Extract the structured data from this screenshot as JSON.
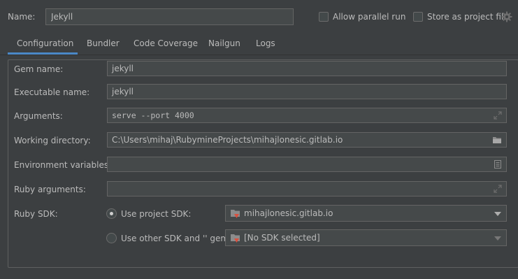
{
  "header": {
    "name_label": "Name:",
    "name_value": "Jekyll",
    "allow_parallel_run": {
      "label": "Allow parallel run",
      "checked": false
    },
    "store_as_project_file": {
      "label": "Store as project file",
      "checked": false
    },
    "settings_icon": "gear-icon"
  },
  "tabs": [
    {
      "label": "Configuration",
      "selected": true
    },
    {
      "label": "Bundler",
      "selected": false
    },
    {
      "label": "Code Coverage",
      "selected": false
    },
    {
      "label": "Nailgun",
      "selected": false
    },
    {
      "label": "Logs",
      "selected": false
    }
  ],
  "form": {
    "gem_name": {
      "label": "Gem name:",
      "value": "jekyll"
    },
    "executable_name": {
      "label": "Executable name:",
      "value": "jekyll"
    },
    "arguments": {
      "label": "Arguments:",
      "value": "serve --port 4000",
      "icon": "expand-icon"
    },
    "working_directory": {
      "label": "Working directory:",
      "value": "C:\\Users\\mihaj\\RubymineProjects\\mihajlonesic.gitlab.io",
      "icon": "folder-icon"
    },
    "environment_variables": {
      "label": "Environment variables:",
      "value": "",
      "icon": "document-icon"
    },
    "ruby_arguments": {
      "label": "Ruby arguments:",
      "value": "",
      "icon": "expand-icon"
    },
    "ruby_sdk": {
      "label": "Ruby SDK:",
      "use_project_sdk": {
        "label": "Use project SDK:",
        "selected": true,
        "value": "mihajlonesic.gitlab.io"
      },
      "use_other_sdk": {
        "label": "Use other SDK and '' gem:",
        "selected": false,
        "value": "[No SDK selected]"
      }
    }
  },
  "colors": {
    "background": "#3c3f41",
    "accent_tab": "#4a88c7",
    "field_bg": "#45494a",
    "sdk_icon_badge": "#d9503f"
  }
}
